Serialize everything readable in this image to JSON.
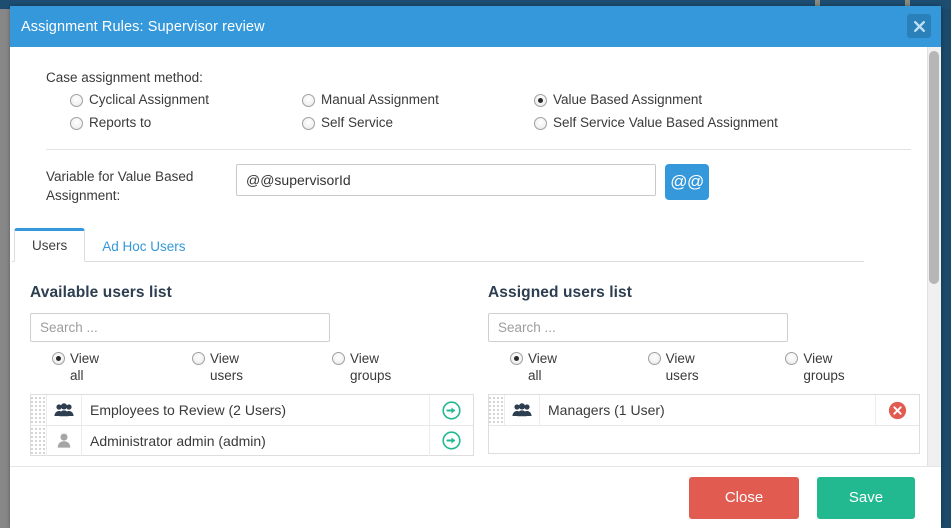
{
  "modal": {
    "title": "Assignment Rules: Supervisor review",
    "close_icon": "close-icon"
  },
  "method": {
    "label": "Case assignment method:",
    "options": [
      {
        "label": "Cyclical Assignment",
        "checked": false
      },
      {
        "label": "Manual Assignment",
        "checked": false
      },
      {
        "label": "Value Based Assignment",
        "checked": true
      },
      {
        "label": "Reports to",
        "checked": false
      },
      {
        "label": "Self Service",
        "checked": false
      },
      {
        "label": "Self Service Value Based Assignment",
        "checked": false
      }
    ]
  },
  "variable": {
    "label": "Variable for Value Based Assignment:",
    "value": "@@supervisorId",
    "placeholder": "",
    "button_label": "@@"
  },
  "tabs": [
    {
      "label": "Users",
      "active": true
    },
    {
      "label": "Ad Hoc Users",
      "active": false
    }
  ],
  "available": {
    "title": "Available users list",
    "search_placeholder": "Search ...",
    "search_value": "",
    "view_options": [
      {
        "label": "View all",
        "checked": true
      },
      {
        "label": "View users",
        "checked": false
      },
      {
        "label": "View groups",
        "checked": false
      }
    ],
    "rows": [
      {
        "label": "Employees to Review (2 Users)",
        "icon": "group-icon",
        "action": "add-icon"
      },
      {
        "label": "Administrator admin (admin)",
        "icon": "user-icon",
        "action": "add-icon"
      }
    ]
  },
  "assigned": {
    "title": "Assigned users list",
    "search_placeholder": "Search ...",
    "search_value": "",
    "view_options": [
      {
        "label": "View all",
        "checked": true
      },
      {
        "label": "View users",
        "checked": false
      },
      {
        "label": "View groups",
        "checked": false
      }
    ],
    "rows": [
      {
        "label": "Managers (1 User)",
        "icon": "group-icon",
        "action": "remove-icon"
      }
    ]
  },
  "footer": {
    "close_label": "Close",
    "save_label": "Save"
  },
  "colors": {
    "header_blue": "#3498db",
    "close_red": "#e15b50",
    "save_green": "#22b890",
    "add_green": "#22b890",
    "remove_red": "#e15b50",
    "group_icon": "#2c3e50",
    "user_icon": "#a5a5a5"
  }
}
